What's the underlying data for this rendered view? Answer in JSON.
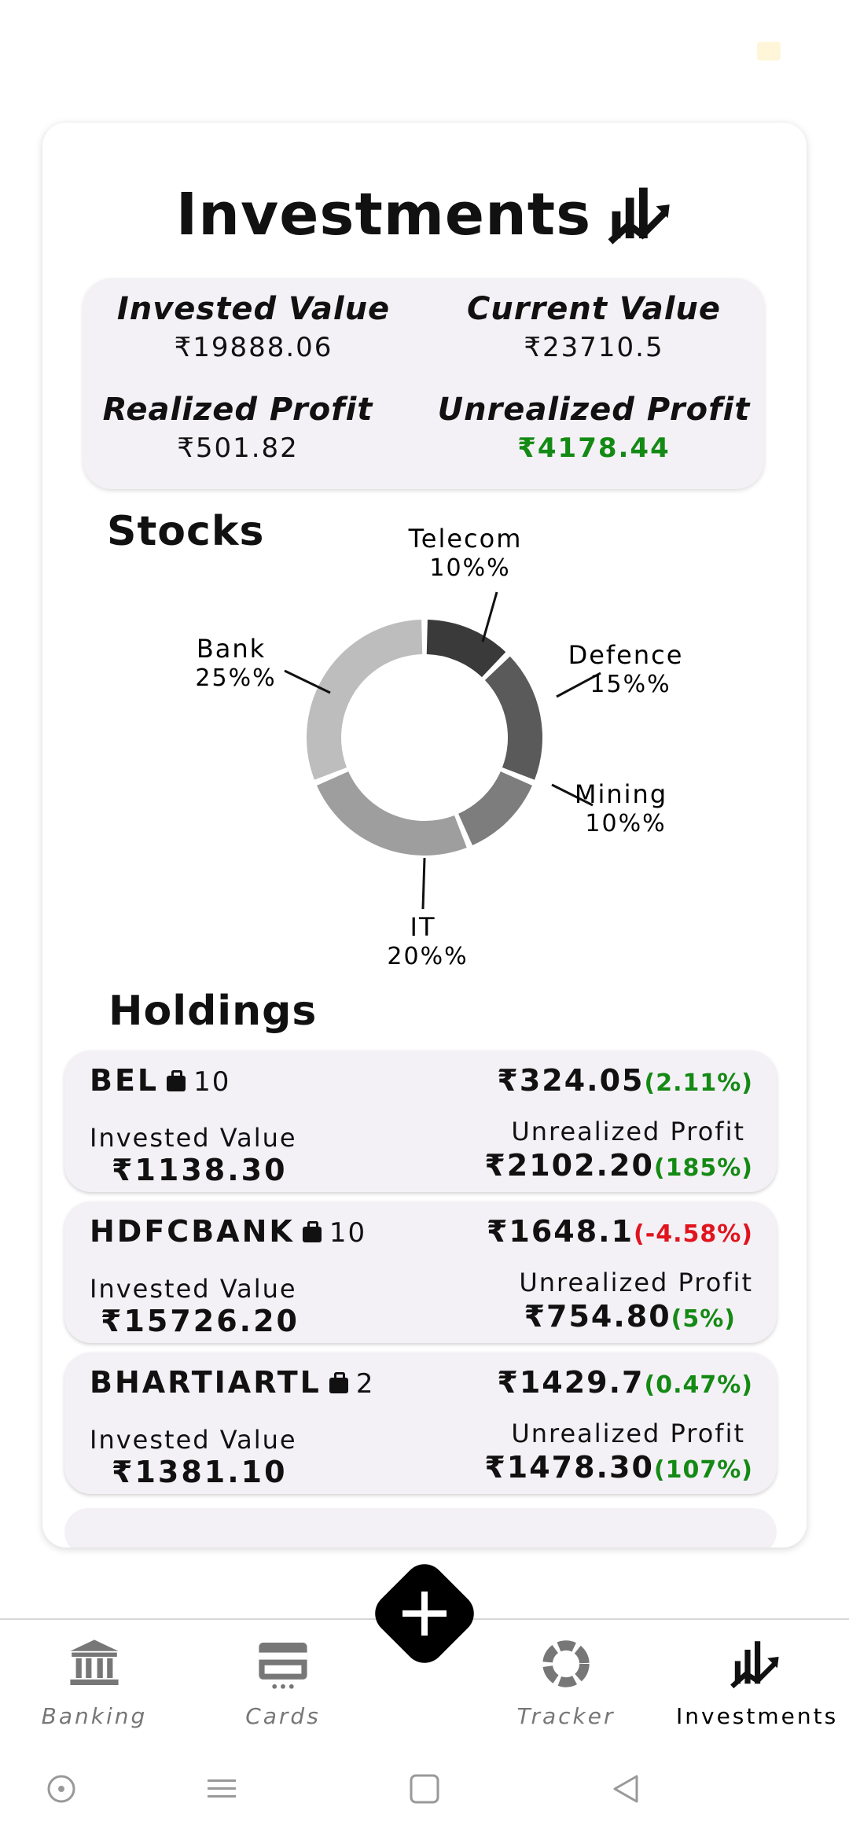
{
  "page": {
    "title": "Investments",
    "title_icon": "chart-trend-icon"
  },
  "summary": {
    "invested_value_label": "Invested Value",
    "invested_value": "₹19888.06",
    "current_value_label": "Current Value",
    "current_value": "₹23710.5",
    "realized_profit_label": "Realized Profit",
    "realized_profit": "₹501.82",
    "unrealized_profit_label": "Unrealized Profit",
    "unrealized_profit": "₹4178.44",
    "profit_color": "#148a14"
  },
  "stocks": {
    "title": "Stocks",
    "segments": [
      {
        "name": "Telecom",
        "label": "10%%",
        "percent": 10,
        "color": "#3a3a3a"
      },
      {
        "name": "Defence",
        "label": "15%%",
        "percent": 15,
        "color": "#5a5a5a"
      },
      {
        "name": "Mining",
        "label": "10%%",
        "percent": 10,
        "color": "#7d7d7d"
      },
      {
        "name": "IT",
        "label": "20%%",
        "percent": 20,
        "color": "#9e9e9e"
      },
      {
        "name": "Bank",
        "label": "25%%",
        "percent": 25,
        "color": "#bdbdbd"
      }
    ]
  },
  "holdings": {
    "title": "Holdings",
    "items": [
      {
        "symbol": "BEL",
        "quantity": "10",
        "price": "₹324.05",
        "change": "(2.11%)",
        "change_color": "#148a14",
        "invested_label": "Invested Value",
        "invested": "₹1138.30",
        "unrealized_label": "Unrealized Profit",
        "unrealized": "₹2102.20",
        "unrealized_pct": "(185%)",
        "unrealized_color": "#148a14"
      },
      {
        "symbol": "HDFCBANK",
        "quantity": "10",
        "price": "₹1648.1",
        "change": "(-4.58%)",
        "change_color": "#e0141e",
        "invested_label": "Invested Value",
        "invested": "₹15726.20",
        "unrealized_label": "Unrealized Profit",
        "unrealized": "₹754.80",
        "unrealized_pct": "(5%)",
        "unrealized_color": "#148a14"
      },
      {
        "symbol": "BHARTIARTL",
        "quantity": "2",
        "price": "₹1429.7",
        "change": "(0.47%)",
        "change_color": "#148a14",
        "invested_label": "Invested Value",
        "invested": "₹1381.10",
        "unrealized_label": "Unrealized Profit",
        "unrealized": "₹1478.30",
        "unrealized_pct": "(107%)",
        "unrealized_color": "#148a14"
      }
    ]
  },
  "nav": {
    "items": [
      {
        "label": "Banking",
        "icon": "bank-icon",
        "active": false
      },
      {
        "label": "Cards",
        "icon": "card-icon",
        "active": false
      },
      {
        "label": "Tracker",
        "icon": "donut-icon",
        "active": false
      },
      {
        "label": "Investments",
        "icon": "chart-trend-icon",
        "active": true
      }
    ],
    "fab_icon": "plus-icon"
  },
  "system_bar": {
    "icons": [
      "circle-icon",
      "menu-icon",
      "square-icon",
      "back-triangle-icon"
    ]
  }
}
